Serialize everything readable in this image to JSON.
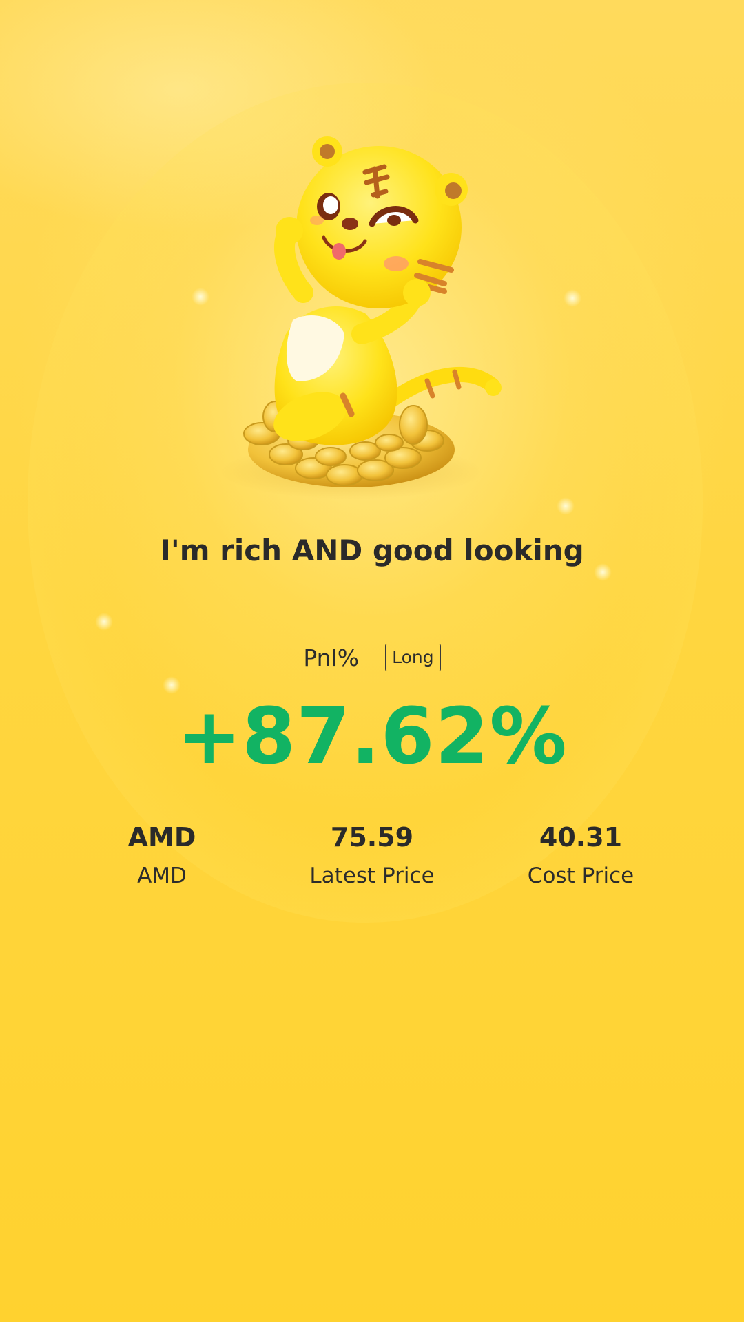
{
  "slogan": "I'm rich AND good looking",
  "pnl": {
    "label": "Pnl%",
    "position_badge": "Long",
    "value": "+87.62%",
    "value_color": "#12b363"
  },
  "stats": [
    {
      "value": "AMD",
      "label": "AMD"
    },
    {
      "value": "75.59",
      "label": "Latest Price"
    },
    {
      "value": "40.31",
      "label": "Cost Price"
    }
  ],
  "mascot": {
    "icon": "tiger-mascot-on-coins-icon"
  },
  "colors": {
    "background": "#ffd640",
    "text": "#2a2a2a",
    "gain": "#12b363"
  }
}
